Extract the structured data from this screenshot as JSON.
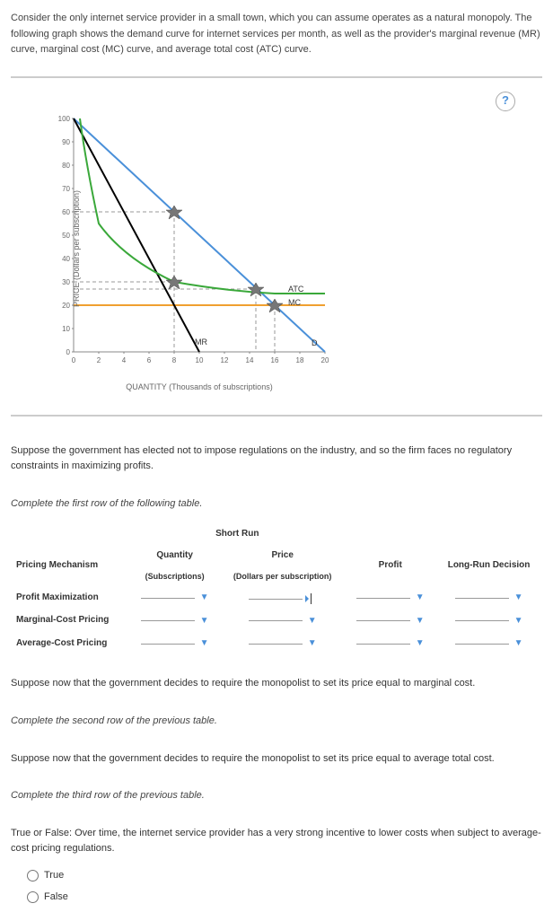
{
  "intro": "Consider the only internet service provider in a small town, which you can assume operates as a natural monopoly. The following graph shows the demand curve for internet services per month, as well as the provider's marginal revenue (MR) curve, marginal cost (MC) curve, and average total cost (ATC) curve.",
  "help_label": "?",
  "chart": {
    "y_axis_label": "PRICE (Dollars per subscription)",
    "x_axis_label": "QUANTITY (Thousands of subscriptions)",
    "y_ticks": [
      "0",
      "10",
      "20",
      "30",
      "40",
      "50",
      "60",
      "70",
      "80",
      "90",
      "100"
    ],
    "x_ticks": [
      "0",
      "2",
      "4",
      "6",
      "8",
      "10",
      "12",
      "14",
      "16",
      "18",
      "20"
    ],
    "curve_labels": {
      "atc": "ATC",
      "mc": "MC",
      "d": "D",
      "mr": "MR"
    }
  },
  "chart_data": {
    "type": "line",
    "xlabel": "QUANTITY (Thousands of subscriptions)",
    "ylabel": "PRICE (Dollars per subscription)",
    "xlim": [
      0,
      20
    ],
    "ylim": [
      0,
      100
    ],
    "series": [
      {
        "name": "D (Demand)",
        "x": [
          0,
          20
        ],
        "y": [
          100,
          0
        ]
      },
      {
        "name": "MR",
        "x": [
          0,
          10
        ],
        "y": [
          100,
          0
        ]
      },
      {
        "name": "MC",
        "x": [
          0,
          20
        ],
        "y": [
          20,
          20
        ]
      },
      {
        "name": "ATC",
        "x": [
          0.5,
          1,
          2,
          4,
          6,
          8,
          10,
          14,
          16,
          20
        ],
        "y": [
          100,
          80,
          55,
          40,
          33,
          30,
          28,
          26,
          25,
          25
        ]
      }
    ],
    "markers": [
      {
        "x": 8,
        "y": 60,
        "note": "Profit max price on D at Q=8"
      },
      {
        "x": 8,
        "y": 30,
        "note": "ATC at Q=8"
      },
      {
        "x": 14.5,
        "y": 27,
        "note": "ATC=D intersection approx"
      },
      {
        "x": 16,
        "y": 20,
        "note": "MC=D intersection"
      }
    ],
    "dashed_guides": [
      {
        "from": [
          0,
          60
        ],
        "to": [
          8,
          60
        ]
      },
      {
        "from": [
          8,
          60
        ],
        "to": [
          8,
          0
        ]
      },
      {
        "from": [
          0,
          30
        ],
        "to": [
          8,
          30
        ]
      },
      {
        "from": [
          0,
          27
        ],
        "to": [
          14.5,
          27
        ]
      },
      {
        "from": [
          14.5,
          27
        ],
        "to": [
          14.5,
          0
        ]
      },
      {
        "from": [
          16,
          20
        ],
        "to": [
          16,
          0
        ]
      }
    ]
  },
  "prompt_no_reg": "Suppose the government has elected not to impose regulations on the industry, and so the firm faces no regulatory constraints in maximizing profits.",
  "complete_first": "Complete the first row of the following table.",
  "table": {
    "group_header": "Short Run",
    "col_mechanism": "Pricing Mechanism",
    "col_qty": "Quantity",
    "col_qty_sub": "(Subscriptions)",
    "col_price": "Price",
    "col_price_sub": "(Dollars per subscription)",
    "col_profit": "Profit",
    "col_lrd": "Long-Run Decision",
    "rows": [
      {
        "label": "Profit Maximization"
      },
      {
        "label": "Marginal-Cost Pricing"
      },
      {
        "label": "Average-Cost Pricing"
      }
    ]
  },
  "prompt_mc": "Suppose now that the government decides to require the monopolist to set its price equal to marginal cost.",
  "complete_second": "Complete the second row of the previous table.",
  "prompt_atc": "Suppose now that the government decides to require the monopolist to set its price equal to average total cost.",
  "complete_third": "Complete the third row of the previous table.",
  "tf_prompt": "True or False: Over time, the internet service provider has a very strong incentive to lower costs when subject to average-cost pricing regulations.",
  "tf_true": "True",
  "tf_false": "False"
}
